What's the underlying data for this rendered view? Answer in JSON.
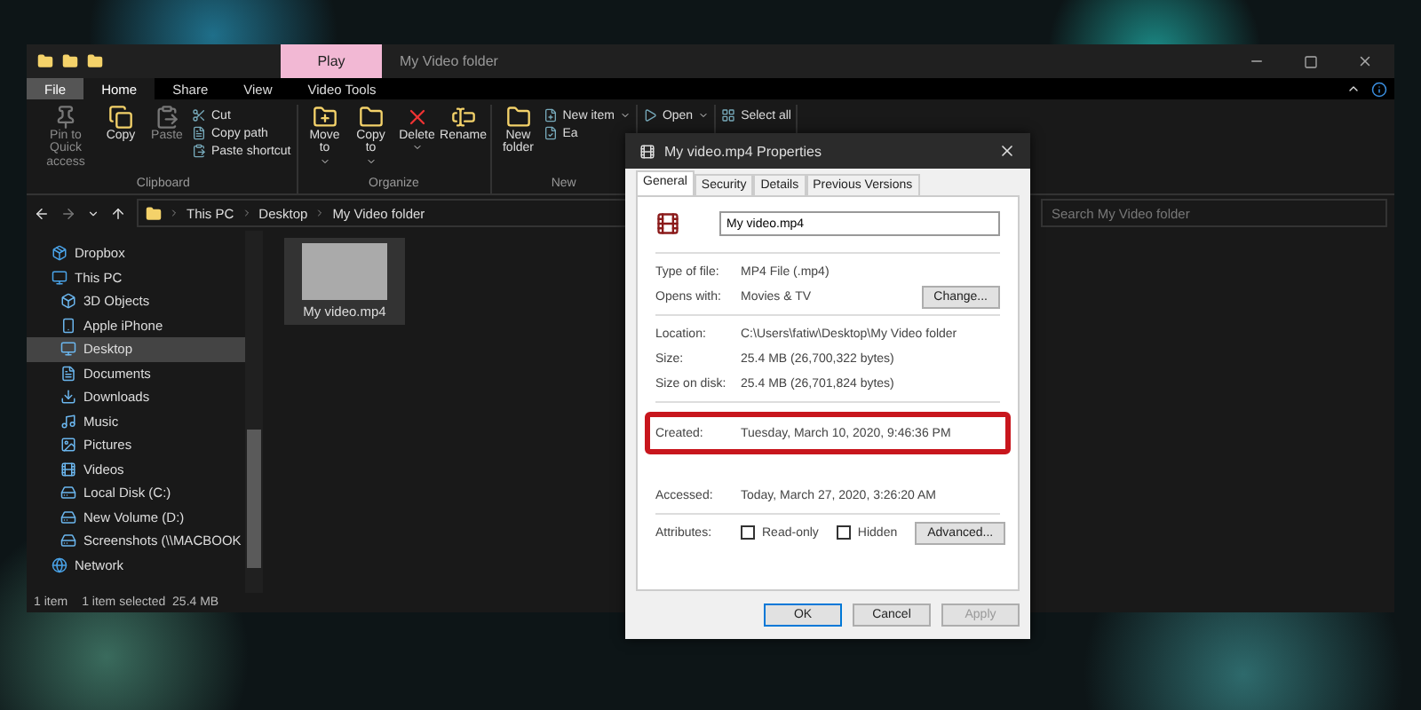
{
  "explorer": {
    "context_tab": "Play",
    "title": "My Video folder",
    "menu_tabs": [
      {
        "label": "File",
        "selected": false,
        "kind": "file"
      },
      {
        "label": "Home",
        "selected": true,
        "kind": "tab"
      },
      {
        "label": "Share",
        "selected": false,
        "kind": "tab"
      },
      {
        "label": "View",
        "selected": false,
        "kind": "tab"
      },
      {
        "label": "Video Tools",
        "selected": false,
        "kind": "tab"
      }
    ],
    "ribbon": [
      {
        "label": "Clipboard",
        "large": [
          {
            "label": "Pin to Quick access",
            "disabled": true,
            "dropdown": false
          },
          {
            "label": "Copy",
            "disabled": false,
            "dropdown": false
          },
          {
            "label": "Paste",
            "disabled": true,
            "dropdown": false
          }
        ],
        "small": [
          {
            "label": "Cut",
            "dropdown": false
          },
          {
            "label": "Copy path",
            "dropdown": false
          },
          {
            "label": "Paste shortcut",
            "dropdown": false
          }
        ]
      },
      {
        "label": "Organize",
        "large": [
          {
            "label": "Move to",
            "disabled": false,
            "dropdown": true
          },
          {
            "label": "Copy to",
            "disabled": false,
            "dropdown": true
          },
          {
            "label": "Delete",
            "disabled": false,
            "dropdown": true
          },
          {
            "label": "Rename",
            "disabled": false,
            "dropdown": false
          }
        ]
      },
      {
        "label": "New",
        "large": [
          {
            "label": "New folder",
            "disabled": false,
            "dropdown": false
          }
        ],
        "small": [
          {
            "label": "New item",
            "dropdown": true
          },
          {
            "label": "Ea",
            "dropdown": false
          }
        ]
      },
      {
        "small": [
          {
            "label": "Open",
            "dropdown": true
          }
        ]
      },
      {
        "small": [
          {
            "label": "Select all",
            "dropdown": false
          }
        ]
      }
    ],
    "breadcrumb": [
      "This PC",
      "Desktop",
      "My Video folder"
    ],
    "search": {
      "placeholder": "Search My Video folder"
    },
    "sidebar": [
      {
        "label": "Dropbox",
        "selected": false
      },
      {
        "label": "This PC",
        "selected": false,
        "children": [
          {
            "label": "3D Objects",
            "selected": false
          },
          {
            "label": "Apple iPhone",
            "selected": false
          },
          {
            "label": "Desktop",
            "selected": true
          },
          {
            "label": "Documents",
            "selected": false
          },
          {
            "label": "Downloads",
            "selected": false
          },
          {
            "label": "Music",
            "selected": false
          },
          {
            "label": "Pictures",
            "selected": false
          },
          {
            "label": "Videos",
            "selected": false
          },
          {
            "label": "Local Disk (C:)",
            "selected": false
          },
          {
            "label": "New Volume (D:)",
            "selected": false
          },
          {
            "label": "Screenshots (\\\\MACBOOK",
            "selected": false
          }
        ]
      },
      {
        "label": "Network",
        "selected": false
      }
    ],
    "files": [
      {
        "name": "My video.mp4",
        "selected": true
      }
    ],
    "status_bar": [
      "1 item",
      "1 item selected  25.4 MB"
    ]
  },
  "dialog": {
    "title": "My video.mp4 Properties",
    "tabs": [
      {
        "label": "General",
        "selected": true
      },
      {
        "label": "Security",
        "selected": false
      },
      {
        "label": "Details",
        "selected": false
      },
      {
        "label": "Previous Versions",
        "selected": false
      }
    ],
    "file_name": "My video.mp4",
    "sections": [
      [
        {
          "label": "Type of file:",
          "value": "MP4 File (.mp4)",
          "highlighted": false
        },
        {
          "label": "Opens with:",
          "value": "Movies & TV",
          "button": "Change...",
          "highlighted": false
        }
      ],
      [
        {
          "label": "Location:",
          "value": "C:\\Users\\fatiw\\Desktop\\My Video folder",
          "highlighted": false
        },
        {
          "label": "Size:",
          "value": "25.4 MB (26,700,322 bytes)",
          "highlighted": false
        },
        {
          "label": "Size on disk:",
          "value": "25.4 MB (26,701,824 bytes)",
          "highlighted": false
        }
      ],
      [
        {
          "label": "Created:",
          "value": "Tuesday, March 10, 2020, 9:46:36 PM",
          "highlighted": true
        },
        {
          "label": "Accessed:",
          "value": "Today, March 27, 2020, 3:26:20 AM",
          "highlighted": false
        }
      ]
    ],
    "attributes": {
      "label": "Attributes:",
      "options": [
        {
          "label": "Read-only",
          "checked": false
        },
        {
          "label": "Hidden",
          "checked": false
        }
      ],
      "button": "Advanced..."
    },
    "buttons": [
      {
        "label": "OK",
        "kind": "default",
        "disabled": false
      },
      {
        "label": "Cancel",
        "kind": "normal",
        "disabled": false
      },
      {
        "label": "Apply",
        "kind": "normal",
        "disabled": true
      }
    ]
  }
}
